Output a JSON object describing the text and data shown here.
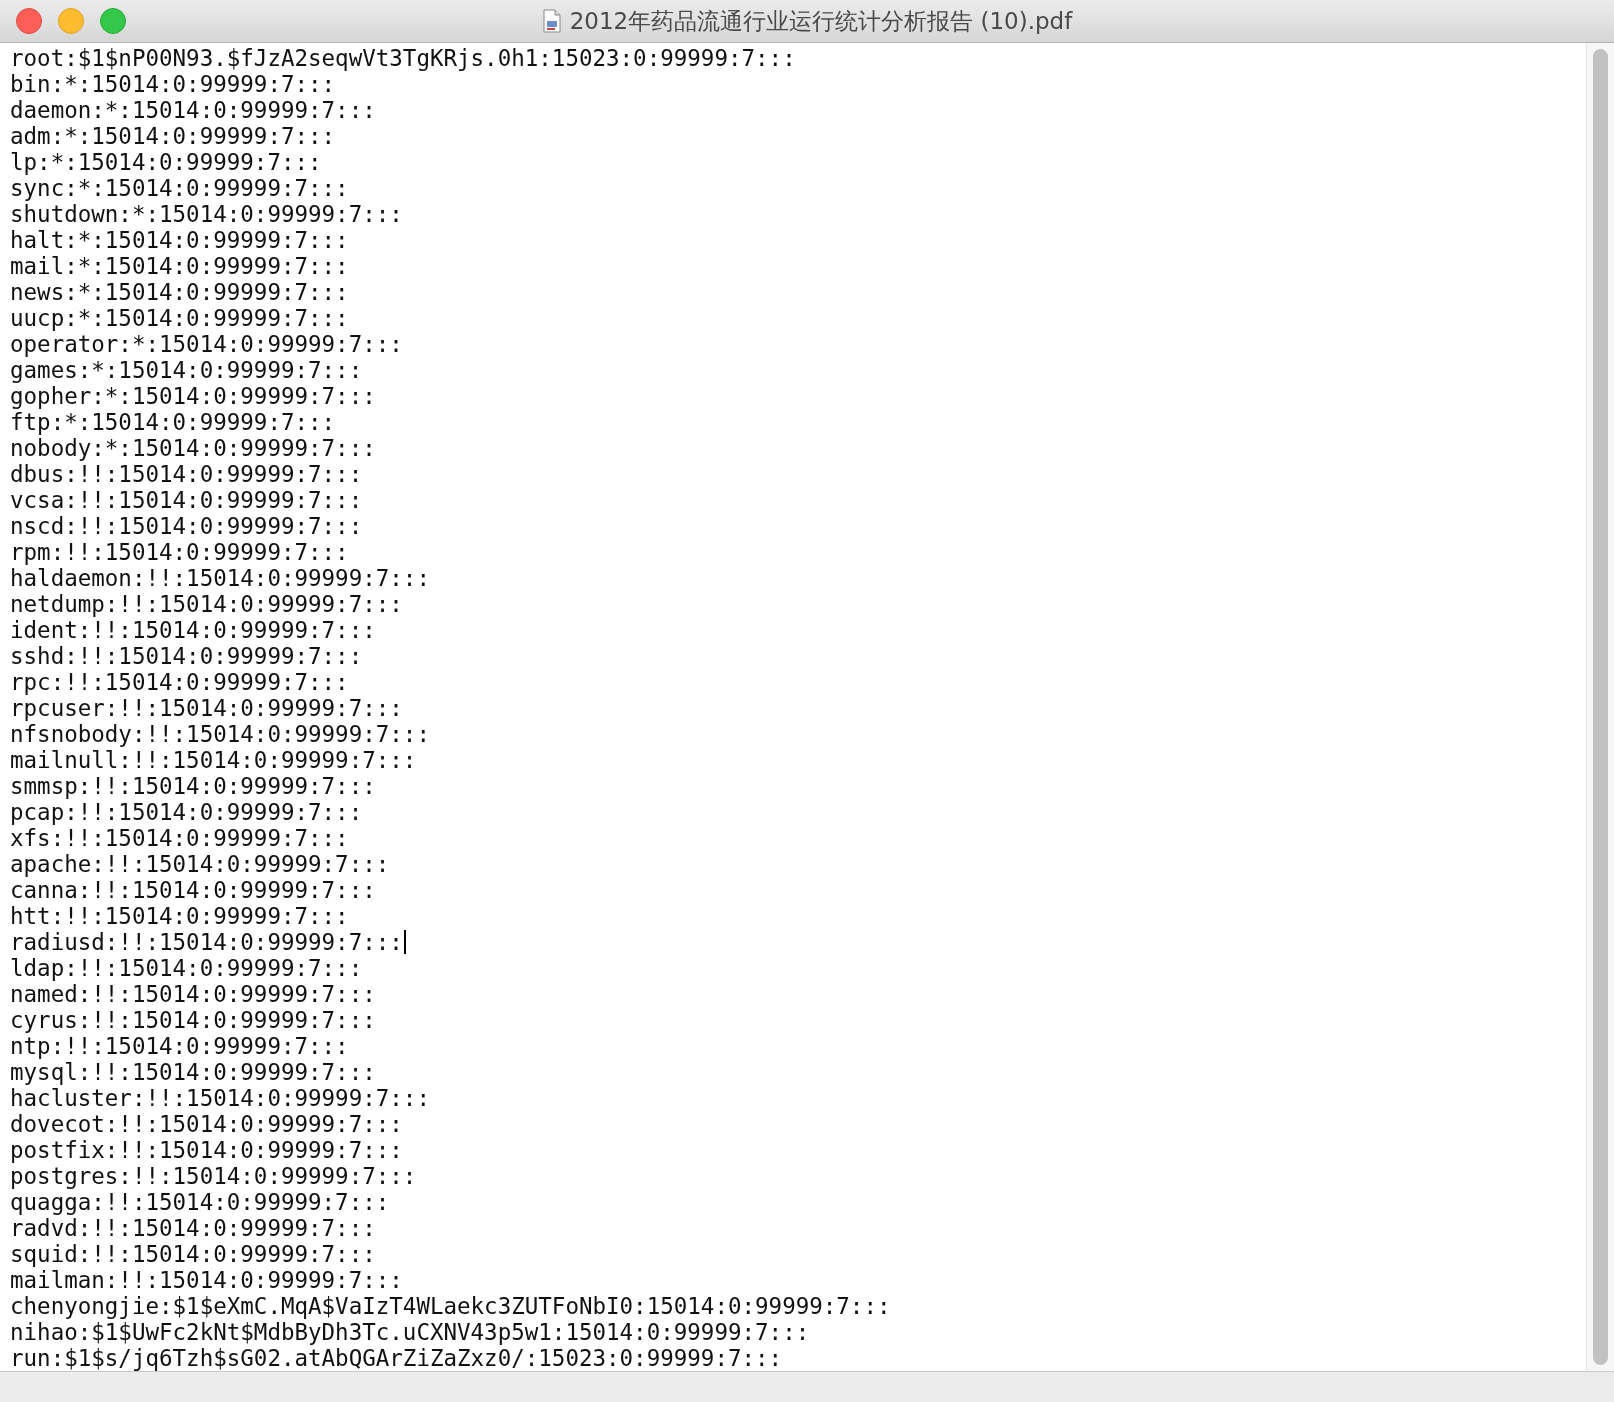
{
  "window": {
    "title": "2012年药品流通行业运行统计分析报告 (10).pdf"
  },
  "lines": [
    {
      "text": "root:$1$nP00N93.$fJzA2seqwVt3TgKRjs.0h1:15023:0:99999:7:::",
      "cursor": false
    },
    {
      "text": "bin:*:15014:0:99999:7:::",
      "cursor": false
    },
    {
      "text": "daemon:*:15014:0:99999:7:::",
      "cursor": false
    },
    {
      "text": "adm:*:15014:0:99999:7:::",
      "cursor": false
    },
    {
      "text": "lp:*:15014:0:99999:7:::",
      "cursor": false
    },
    {
      "text": "sync:*:15014:0:99999:7:::",
      "cursor": false
    },
    {
      "text": "shutdown:*:15014:0:99999:7:::",
      "cursor": false
    },
    {
      "text": "halt:*:15014:0:99999:7:::",
      "cursor": false
    },
    {
      "text": "mail:*:15014:0:99999:7:::",
      "cursor": false
    },
    {
      "text": "news:*:15014:0:99999:7:::",
      "cursor": false
    },
    {
      "text": "uucp:*:15014:0:99999:7:::",
      "cursor": false
    },
    {
      "text": "operator:*:15014:0:99999:7:::",
      "cursor": false
    },
    {
      "text": "games:*:15014:0:99999:7:::",
      "cursor": false
    },
    {
      "text": "gopher:*:15014:0:99999:7:::",
      "cursor": false
    },
    {
      "text": "ftp:*:15014:0:99999:7:::",
      "cursor": false
    },
    {
      "text": "nobody:*:15014:0:99999:7:::",
      "cursor": false
    },
    {
      "text": "dbus:!!:15014:0:99999:7:::",
      "cursor": false
    },
    {
      "text": "vcsa:!!:15014:0:99999:7:::",
      "cursor": false
    },
    {
      "text": "nscd:!!:15014:0:99999:7:::",
      "cursor": false
    },
    {
      "text": "rpm:!!:15014:0:99999:7:::",
      "cursor": false
    },
    {
      "text": "haldaemon:!!:15014:0:99999:7:::",
      "cursor": false
    },
    {
      "text": "netdump:!!:15014:0:99999:7:::",
      "cursor": false
    },
    {
      "text": "ident:!!:15014:0:99999:7:::",
      "cursor": false
    },
    {
      "text": "sshd:!!:15014:0:99999:7:::",
      "cursor": false
    },
    {
      "text": "rpc:!!:15014:0:99999:7:::",
      "cursor": false
    },
    {
      "text": "rpcuser:!!:15014:0:99999:7:::",
      "cursor": false
    },
    {
      "text": "nfsnobody:!!:15014:0:99999:7:::",
      "cursor": false
    },
    {
      "text": "mailnull:!!:15014:0:99999:7:::",
      "cursor": false
    },
    {
      "text": "smmsp:!!:15014:0:99999:7:::",
      "cursor": false
    },
    {
      "text": "pcap:!!:15014:0:99999:7:::",
      "cursor": false
    },
    {
      "text": "xfs:!!:15014:0:99999:7:::",
      "cursor": false
    },
    {
      "text": "apache:!!:15014:0:99999:7:::",
      "cursor": false
    },
    {
      "text": "canna:!!:15014:0:99999:7:::",
      "cursor": false
    },
    {
      "text": "htt:!!:15014:0:99999:7:::",
      "cursor": false
    },
    {
      "text": "radiusd:!!:15014:0:99999:7:::",
      "cursor": true
    },
    {
      "text": "ldap:!!:15014:0:99999:7:::",
      "cursor": false
    },
    {
      "text": "named:!!:15014:0:99999:7:::",
      "cursor": false
    },
    {
      "text": "cyrus:!!:15014:0:99999:7:::",
      "cursor": false
    },
    {
      "text": "ntp:!!:15014:0:99999:7:::",
      "cursor": false
    },
    {
      "text": "mysql:!!:15014:0:99999:7:::",
      "cursor": false
    },
    {
      "text": "hacluster:!!:15014:0:99999:7:::",
      "cursor": false
    },
    {
      "text": "dovecot:!!:15014:0:99999:7:::",
      "cursor": false
    },
    {
      "text": "postfix:!!:15014:0:99999:7:::",
      "cursor": false
    },
    {
      "text": "postgres:!!:15014:0:99999:7:::",
      "cursor": false
    },
    {
      "text": "quagga:!!:15014:0:99999:7:::",
      "cursor": false
    },
    {
      "text": "radvd:!!:15014:0:99999:7:::",
      "cursor": false
    },
    {
      "text": "squid:!!:15014:0:99999:7:::",
      "cursor": false
    },
    {
      "text": "mailman:!!:15014:0:99999:7:::",
      "cursor": false
    },
    {
      "text": "chenyongjie:$1$eXmC.MqA$VaIzT4WLaekc3ZUTFoNbI0:15014:0:99999:7:::",
      "cursor": false
    },
    {
      "text": "nihao:$1$UwFc2kNt$MdbByDh3Tc.uCXNV43p5w1:15014:0:99999:7:::",
      "cursor": false
    },
    {
      "text": "run:$1$s/jq6Tzh$sG02.atAbQGArZiZaZxz0/:15023:0:99999:7:::",
      "cursor": false
    }
  ]
}
